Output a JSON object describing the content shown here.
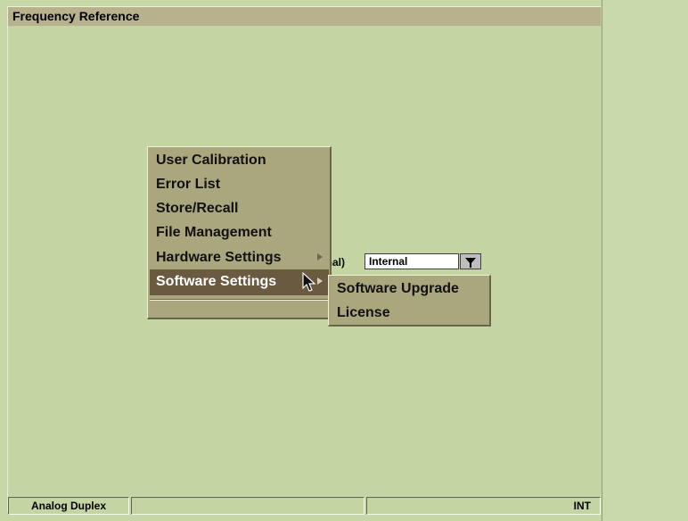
{
  "window": {
    "title": "Frequency Reference"
  },
  "background_field": {
    "partial_label": "rnal)",
    "dropdown_value": "Internal"
  },
  "menu": {
    "items": [
      {
        "label": "User Calibration",
        "has_submenu": false,
        "selected": false
      },
      {
        "label": "Error List",
        "has_submenu": false,
        "selected": false
      },
      {
        "label": "Store/Recall",
        "has_submenu": false,
        "selected": false
      },
      {
        "label": "File Management",
        "has_submenu": false,
        "selected": false
      },
      {
        "label": "Hardware Settings",
        "has_submenu": true,
        "selected": false
      },
      {
        "label": "Software Settings",
        "has_submenu": true,
        "selected": true
      }
    ]
  },
  "submenu": {
    "items": [
      {
        "label": "Software Upgrade"
      },
      {
        "label": "License"
      }
    ]
  },
  "status_bar": {
    "left": "Analog Duplex",
    "center": "",
    "right": "INT"
  },
  "icons": {
    "pointer": "mouse-pointer-icon",
    "dropdown": "chevron-down-icon",
    "submenu": "submenu-arrow-icon"
  },
  "colors": {
    "background": "#c7d7a6",
    "menu_background": "#aaa67e",
    "menu_selected": "#6a5a40",
    "title_bar": "#b7b18d"
  }
}
